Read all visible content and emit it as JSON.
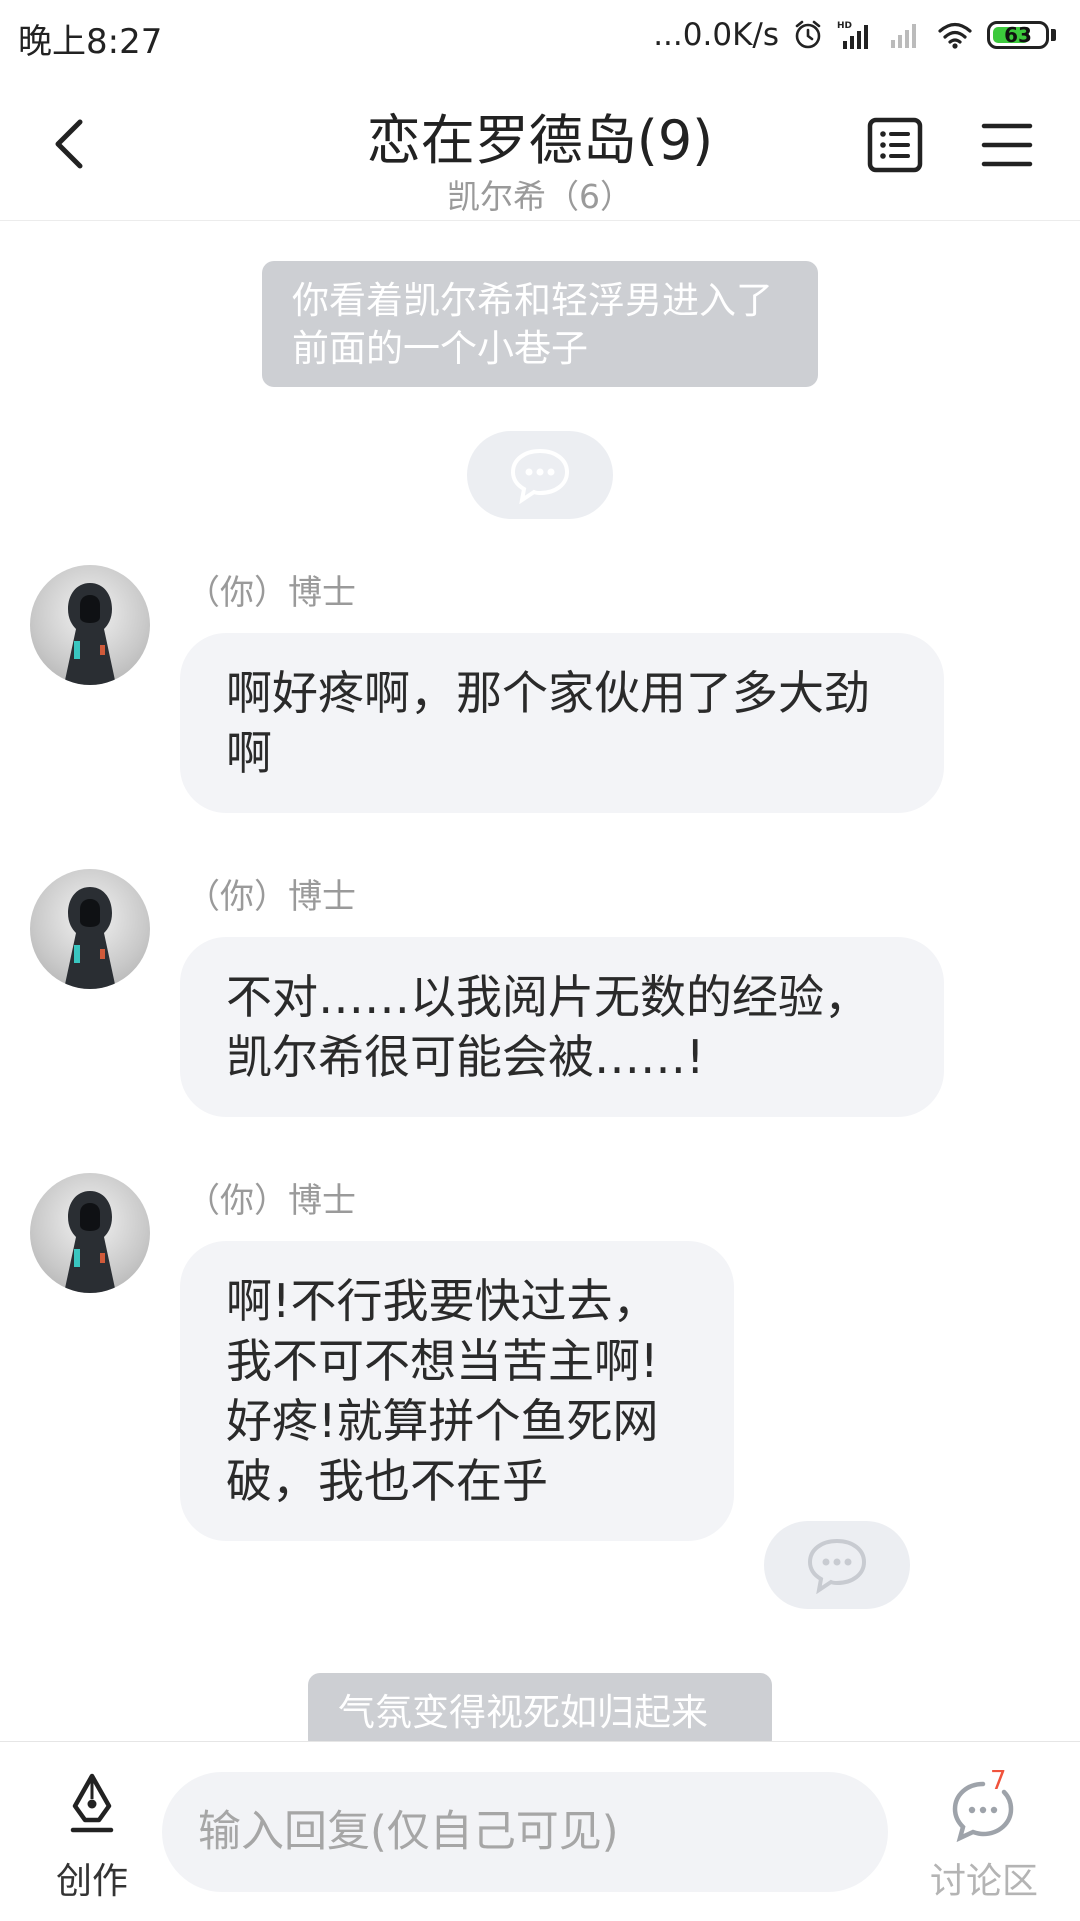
{
  "status_bar": {
    "time": "晚上8:27",
    "net_speed": "...0.0K/s",
    "battery": "63",
    "battery_color": "#3cc93c"
  },
  "header": {
    "title": "恋在罗德岛(9)",
    "subtitle": "凯尔希（6）",
    "icons": [
      "back-arrow-icon",
      "catalog-icon",
      "menu-icon"
    ]
  },
  "messages": [
    {
      "type": "narration",
      "text": "你看着凯尔希和轻浮男进入了前面的一个小巷子"
    },
    {
      "type": "chat",
      "sender": "（你）博士",
      "text": "啊好疼啊，那个家伙用了多大劲啊"
    },
    {
      "type": "chat",
      "sender": "（你）博士",
      "text": "不对……以我阅片无数的经验，凯尔希很可能会被……!"
    },
    {
      "type": "chat",
      "sender": "（你）博士",
      "text": "啊!不行我要快过去，我不可不想当苦主啊!好疼!就算拼个鱼死网破，我也不在乎"
    },
    {
      "type": "narration",
      "text": "气氛变得视死如归起来"
    }
  ],
  "bottom_bar": {
    "create_label": "创作",
    "input_placeholder": "输入回复(仅自己可见)",
    "discussion_label": "讨论区",
    "discussion_badge": "7",
    "badge_color": "#f0533c"
  }
}
